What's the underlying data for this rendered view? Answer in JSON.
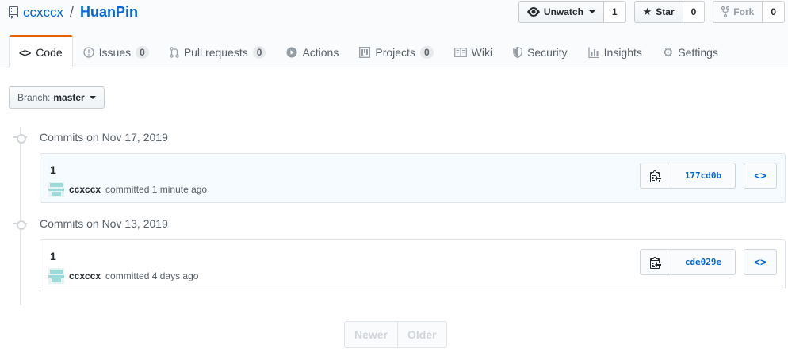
{
  "repo": {
    "owner": "ccxccx",
    "separator": "/",
    "name": "HuanPin"
  },
  "actions": {
    "watch_label": "Unwatch",
    "watch_count": "1",
    "star_label": "Star",
    "star_count": "0",
    "fork_label": "Fork",
    "fork_count": "0"
  },
  "nav": {
    "code": "Code",
    "issues": "Issues",
    "issues_count": "0",
    "pulls": "Pull requests",
    "pulls_count": "0",
    "actions": "Actions",
    "projects": "Projects",
    "projects_count": "0",
    "wiki": "Wiki",
    "security": "Security",
    "insights": "Insights",
    "settings": "Settings"
  },
  "branch": {
    "prefix": "Branch:",
    "name": "master"
  },
  "commit_groups": [
    {
      "title": "Commits on Nov 17, 2019",
      "commit": {
        "message": "1",
        "author": "ccxccx",
        "meta": "committed 1 minute ago",
        "sha": "177cd0b"
      }
    },
    {
      "title": "Commits on Nov 13, 2019",
      "commit": {
        "message": "1",
        "author": "ccxccx",
        "meta": "committed 4 days ago",
        "sha": "cde029e"
      }
    }
  ],
  "pagination": {
    "newer": "Newer",
    "older": "Older"
  },
  "colors": {
    "link": "#0366d6",
    "selected_tab_accent": "#e36209",
    "highlight_row": "#f6fbff"
  }
}
